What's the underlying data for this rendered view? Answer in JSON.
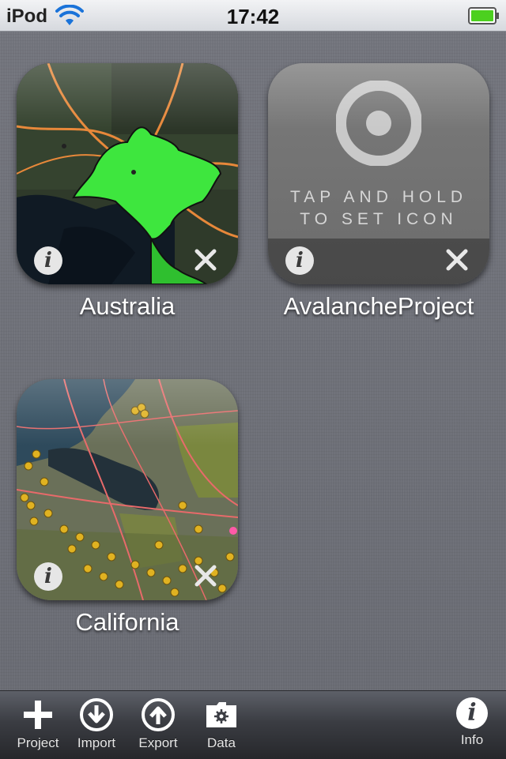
{
  "status_bar": {
    "carrier": "iPod",
    "time": "17:42"
  },
  "projects": [
    {
      "name": "Australia"
    },
    {
      "name": "AvalancheProject",
      "hint_line1": "TAP AND HOLD",
      "hint_line2": "TO SET ICON"
    },
    {
      "name": "California"
    }
  ],
  "tile_buttons": {
    "info_glyph": "i"
  },
  "toolbar": {
    "project_label": "Project",
    "import_label": "Import",
    "export_label": "Export",
    "data_label": "Data",
    "info_label": "Info",
    "info_glyph": "i"
  },
  "colors": {
    "battery": "#4cd01f",
    "wifi": "#1a73d9",
    "shape_green": "#3ee63e"
  }
}
